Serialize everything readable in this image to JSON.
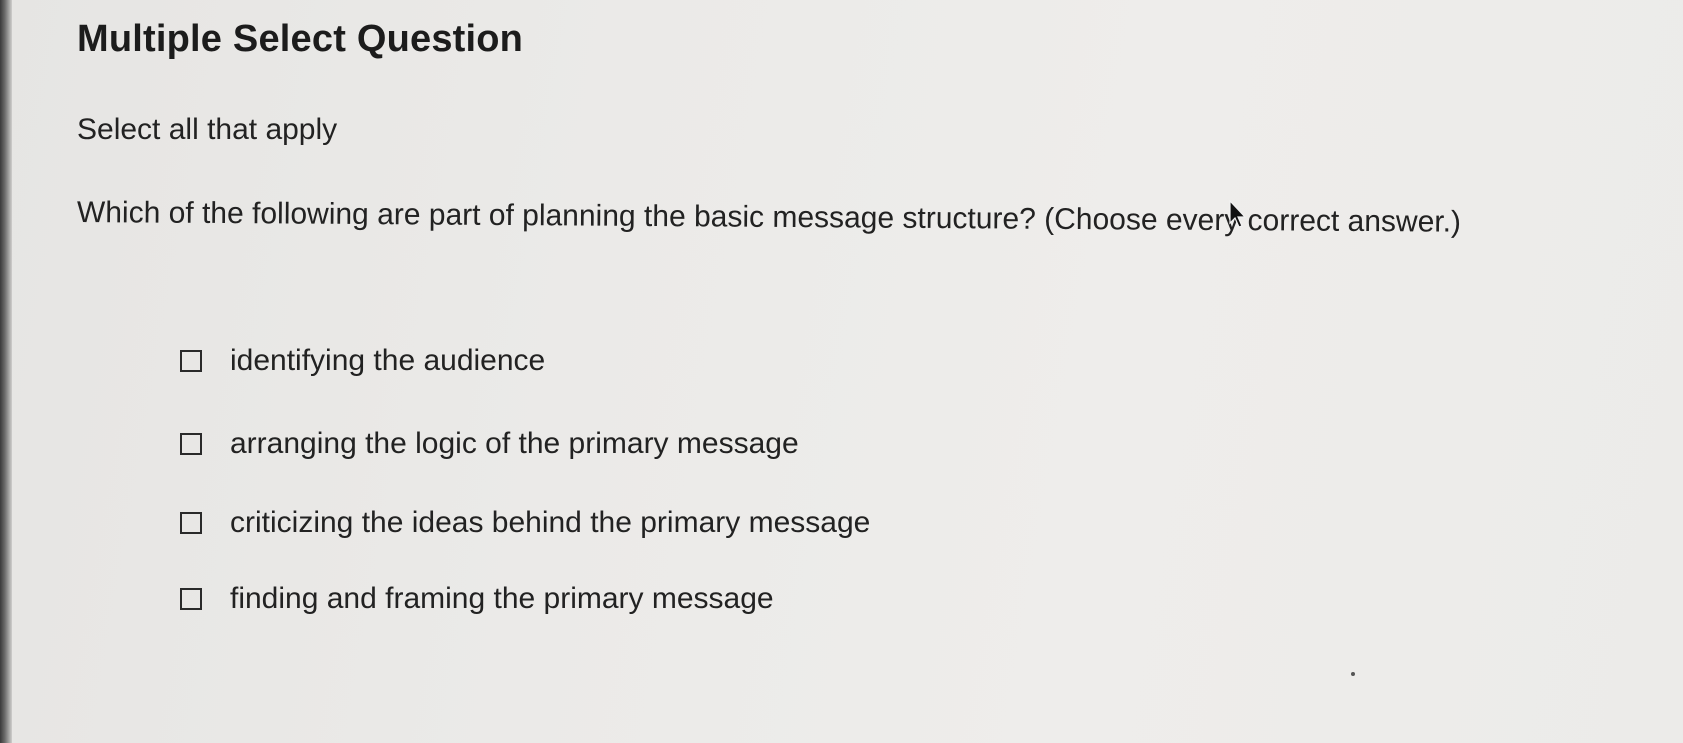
{
  "question": {
    "type_label": "Multiple Select Question",
    "instruction": "Select all that apply",
    "prompt": "Which of the following are part of planning the basic message structure? (Choose every correct answer.)"
  },
  "options": [
    {
      "label": "identifying the audience",
      "checked": false
    },
    {
      "label": "arranging the logic of the primary message",
      "checked": false
    },
    {
      "label": "criticizing the ideas behind the primary message",
      "checked": false
    },
    {
      "label": "finding and framing the primary message",
      "checked": false
    }
  ],
  "icons": {
    "checkbox": "checkbox-icon",
    "cursor": "mouse-pointer-icon"
  },
  "colors": {
    "background": "#eceae8",
    "text": "#222222",
    "checkbox_border": "#2a2a2a"
  }
}
